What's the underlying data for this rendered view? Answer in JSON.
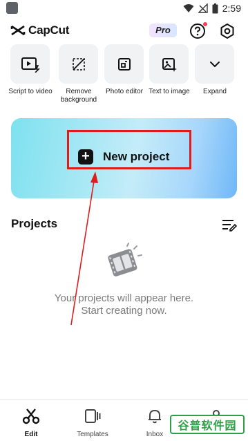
{
  "status_bar": {
    "time": "2:59"
  },
  "header": {
    "app_name": "CapCut",
    "pro_badge": "Pro"
  },
  "tools": [
    {
      "label": "Script to video",
      "icon": "script-video-icon"
    },
    {
      "label": "Remove background",
      "icon": "remove-background-icon"
    },
    {
      "label": "Photo editor",
      "icon": "photo-editor-icon"
    },
    {
      "label": "Text to image",
      "icon": "text-to-image-icon"
    },
    {
      "label": "Expand",
      "icon": "chevron-down-icon"
    }
  ],
  "banner": {
    "new_project_label": "New project"
  },
  "projects": {
    "title": "Projects",
    "empty_line1": "Your projects will appear here.",
    "empty_line2": "Start creating now."
  },
  "bottom_nav": [
    {
      "label": "Edit",
      "active": true
    },
    {
      "label": "Templates",
      "active": false
    },
    {
      "label": "Inbox",
      "active": false
    },
    {
      "label": "",
      "active": false
    }
  ],
  "watermark": {
    "text": "谷普软件园"
  },
  "colors": {
    "highlight": "#e01b1b",
    "notification_dot": "#ff3b5c",
    "watermark": "#2f9e48"
  }
}
